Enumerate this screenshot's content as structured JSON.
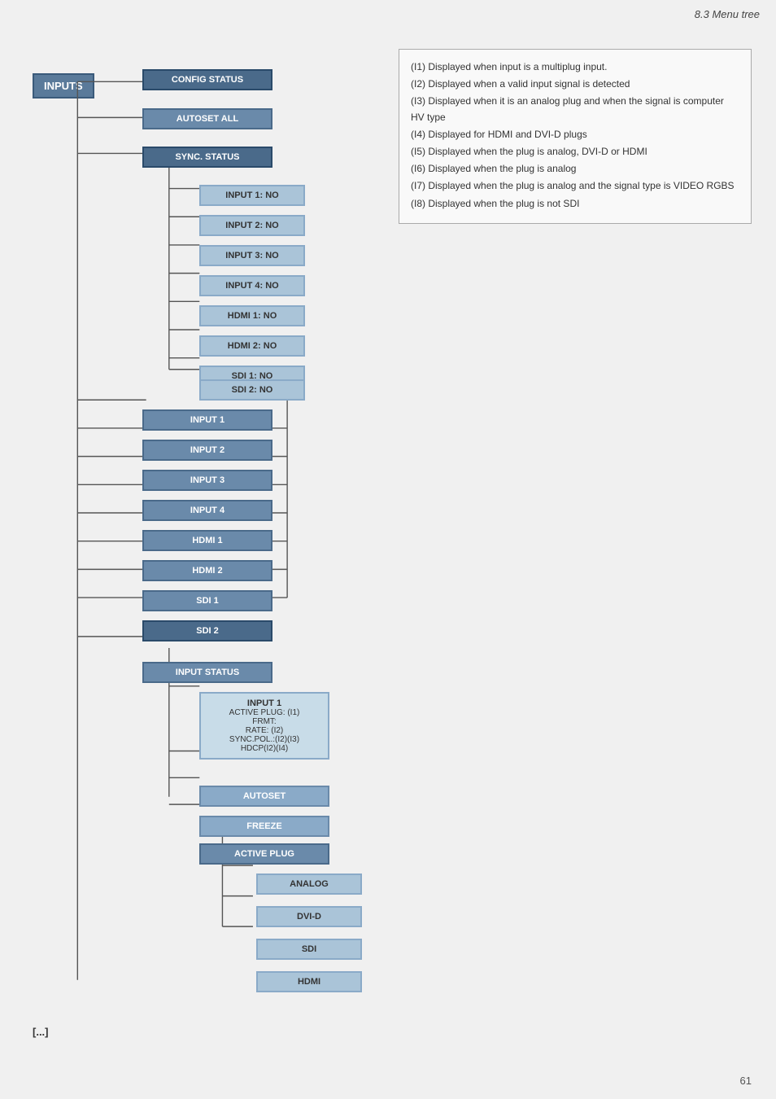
{
  "header": {
    "title": "8.3 Menu tree"
  },
  "footer": {
    "page_number": "61"
  },
  "info_items": [
    "(I1) Displayed when input is a multiplug input.",
    "(I2) Displayed when a valid input signal is detected",
    "(I3) Displayed when it is an analog plug and when the signal is computer HV type",
    "(I4) Displayed for HDMI and DVI-D plugs",
    "(I5) Displayed when the plug is analog, DVI-D or HDMI",
    "(I6) Displayed when the plug is analog",
    "(I7) Displayed when the plug is analog and the signal type is VIDEO RGBS",
    "(I8) Displayed when the plug is not SDI"
  ],
  "inputs_label": "INPUTS",
  "ellipsis": "[...]",
  "nodes": {
    "config_status": "CONFIG STATUS",
    "autoset_all": "AUTOSET ALL",
    "sync_status": "SYNC. STATUS",
    "input1_no": "INPUT 1: NO",
    "input2_no": "INPUT 2: NO",
    "input3_no": "INPUT 3: NO",
    "input4_no": "INPUT 4: NO",
    "hdmi1_no": "HDMI 1: NO",
    "hdmi2_no": "HDMI 2: NO",
    "sdi1_no": "SDI 1: NO",
    "sdi2_no": "SDI 2: NO",
    "input1": "INPUT 1",
    "input2": "INPUT 2",
    "input3": "INPUT 3",
    "input4": "INPUT 4",
    "hdmi1": "HDMI 1",
    "hdmi2": "HDMI 2",
    "sdi1": "SDI 1",
    "sdi2": "SDI 2",
    "input_status": "INPUT STATUS",
    "input1_detail_title": "INPUT 1",
    "active_plug": "ACTIVE PLUG: (I1)",
    "frmt": "FRMT:",
    "rate": "RATE: (I2)",
    "sync_pol": "SYNC.POL.:(I2)(I3)",
    "hdcp": "HDCP(I2)(I4)",
    "autoset": "AUTOSET",
    "freeze": "FREEZE",
    "active_plug_main": "ACTIVE PLUG",
    "analog": "ANALOG",
    "dvi_d": "DVI-D",
    "sdi": "SDI",
    "hdmi": "HDMI"
  }
}
